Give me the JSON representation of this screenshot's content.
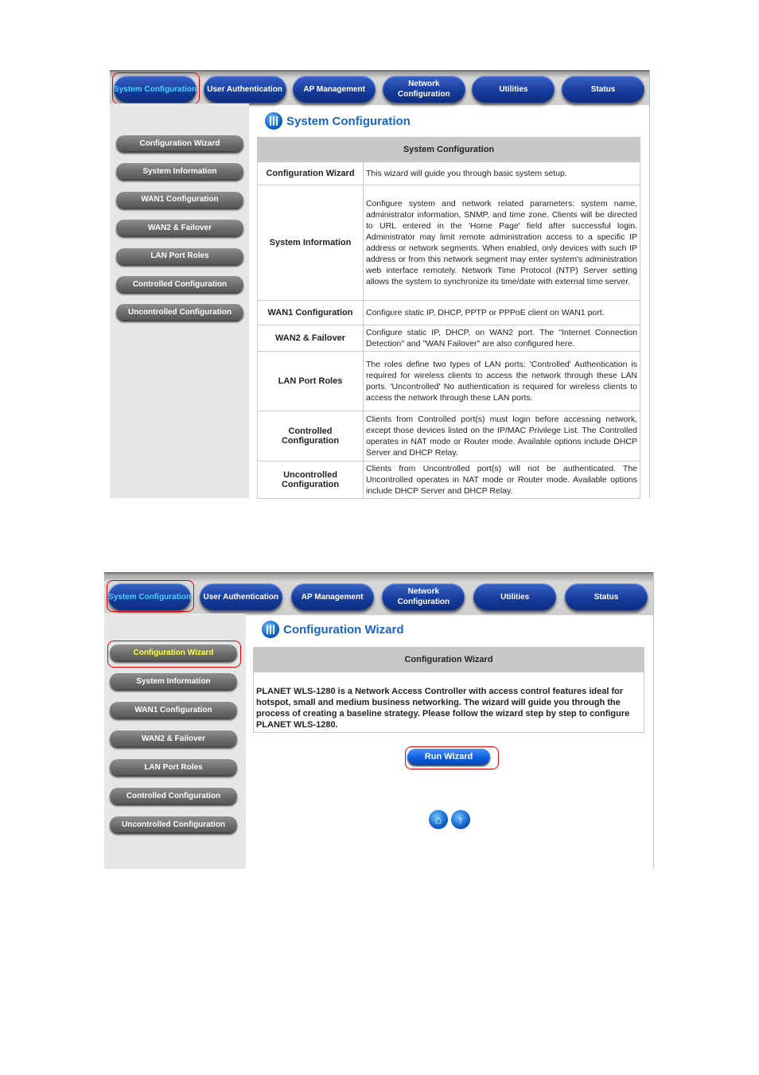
{
  "nav_tabs": [
    "System Configuration",
    "User Authentication",
    "AP Management",
    "Network Configuration",
    "Utilities",
    "Status"
  ],
  "sidebar_items": [
    "Configuration Wizard",
    "System Information",
    "WAN1 Configuration",
    "WAN2 & Failover",
    "LAN Port Roles",
    "Controlled Configuration",
    "Uncontrolled Configuration"
  ],
  "shot1": {
    "title": "System Configuration",
    "table_header": "System Configuration",
    "rows": [
      {
        "key": "Configuration Wizard",
        "value": "This wizard will guide you through basic system setup."
      },
      {
        "key": "System Information",
        "value": "Configure system and network related parameters: system name, administrator information, SNMP, and time zone. Clients will be directed to URL entered in the 'Home Page' field after successful login. Administrator may limit remote administration access to a specific IP address or network segments. When enabled, only devices with such IP address or from this network segment may enter system's administration web interface remotely. Network Time Protocol (NTP) Server setting allows the system to synchronize its time/date with external time server."
      },
      {
        "key": "WAN1 Configuration",
        "value": "Configure static IP, DHCP, PPTP or PPPoE client on WAN1 port."
      },
      {
        "key": "WAN2 & Failover",
        "value": "Configure static IP, DHCP, on WAN2 port. The \"Internet Connection Detection\" and \"WAN Failover\" are also configured here."
      },
      {
        "key": "LAN Port Roles",
        "value": "The roles define two types of LAN ports: 'Controlled' Authentication is required for wireless clients to access the network through these LAN ports. 'Uncontrolled' No authentication is required for wireless clients to access the network through these LAN ports."
      },
      {
        "key": "Controlled Configuration",
        "value": "Clients from Controlled port(s) must login before accessing network, except those devices listed on the IP/MAC Privilege List. The Controlled operates in NAT mode or Router mode. Available options include DHCP Server and DHCP Relay."
      },
      {
        "key": "Uncontrolled Configuration",
        "value": "Clients from Uncontrolled port(s) will not be authenticated. The Uncontrolled operates in NAT mode or Router mode. Available options include DHCP Server and DHCP Relay."
      }
    ]
  },
  "shot2": {
    "title": "Configuration Wizard",
    "table_header": "Configuration Wizard",
    "description": "PLANET WLS-1280 is a Network Access Controller with access control features ideal for hotspot, small and medium business networking. The wizard will guide you through the process of creating a baseline strategy. Please follow the wizard step by step to configure PLANET WLS-1280.",
    "run_button": "Run Wizard",
    "icons": [
      "home-icon",
      "up-arrow-icon"
    ]
  },
  "colors": {
    "highlight": "#e00000",
    "accent": "#1a64c8",
    "active_tab_text": "#4fd0ff",
    "active_side_text": "#ffff40"
  }
}
